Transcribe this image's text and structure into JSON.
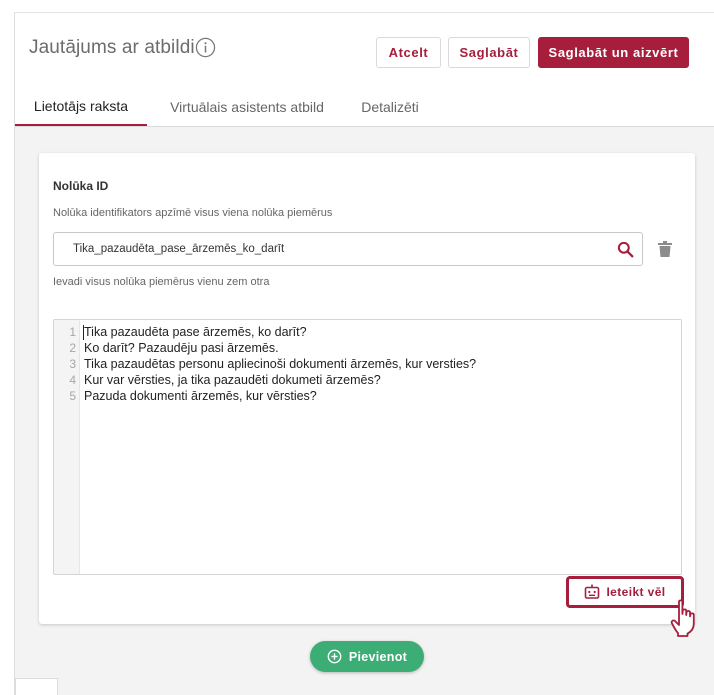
{
  "header": {
    "title": "Jautājums ar atbildi",
    "cancel_label": "Atcelt",
    "save_label": "Saglabāt",
    "save_close_label": "Saglabāt un aizvērt"
  },
  "tabs": [
    {
      "label": "Lietotājs raksta",
      "active": true
    },
    {
      "label": "Virtuālais asistents atbild",
      "active": false
    },
    {
      "label": "Detalizēti",
      "active": false
    }
  ],
  "intent": {
    "label": "Nolūka ID",
    "description": "Nolūka identifikators apzīmē visus viena nolūka piemērus",
    "value": "Tika_pazaudēta_pase_ārzemēs_ko_darīt",
    "examples_hint": "Ievadi visus nolūka piemērus vienu zem otra"
  },
  "editor": {
    "lines": [
      {
        "num": "1",
        "text": "Tika pazaudēta pase ārzemēs, ko darīt?"
      },
      {
        "num": "2",
        "text": "Ko darīt? Pazaudēju pasi ārzemēs."
      },
      {
        "num": "3",
        "text": "Tika pazaudētas personu apliecinoši dokumenti ārzemēs, kur versties?"
      },
      {
        "num": "4",
        "text": "Kur var vērsties, ja tika pazaudēti dokumeti ārzemēs?"
      },
      {
        "num": "5",
        "text": "Pazuda dokumenti ārzemēs, kur vērsties?"
      }
    ]
  },
  "actions": {
    "suggest_label": "Ieteikt vēl",
    "add_label": "Pievienot"
  },
  "icons": {
    "info": "info-icon",
    "search": "search-icon",
    "trash": "trash-icon",
    "robot": "robot-icon",
    "cursor": "hand-cursor-icon",
    "add": "plus-circle-icon"
  },
  "colors": {
    "brand": "#a61e3c",
    "success": "#3cad74",
    "background": "#f3f3f3"
  }
}
